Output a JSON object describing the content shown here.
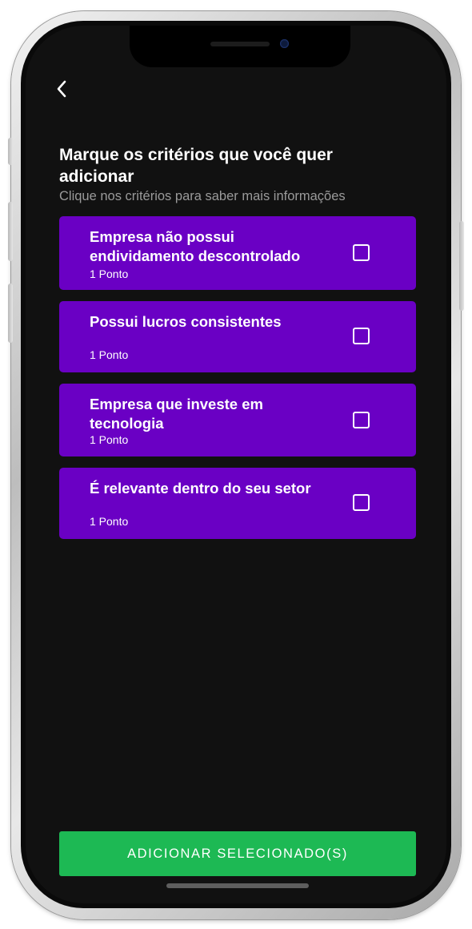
{
  "header": {
    "back_icon": "chevron-left-icon"
  },
  "page": {
    "title": "Marque os critérios que você quer adicionar",
    "subtitle": "Clique nos critérios para saber mais informações"
  },
  "criteria": [
    {
      "title": "Empresa não possui endividamento descontrolado",
      "points": "1 Ponto",
      "checked": false
    },
    {
      "title": "Possui lucros consistentes",
      "points": "1 Ponto",
      "checked": false
    },
    {
      "title": "Empresa que investe em tecnologia",
      "points": "1 Ponto",
      "checked": false
    },
    {
      "title": "É relevante dentro do seu setor",
      "points": "1 Ponto",
      "checked": false
    }
  ],
  "footer": {
    "add_button_label": "ADICIONAR SELECIONADO(S)"
  },
  "colors": {
    "background": "#111111",
    "card": "#6a00c4",
    "primary_button": "#1db954",
    "text": "#ffffff",
    "muted_text": "#9a9a9a"
  }
}
